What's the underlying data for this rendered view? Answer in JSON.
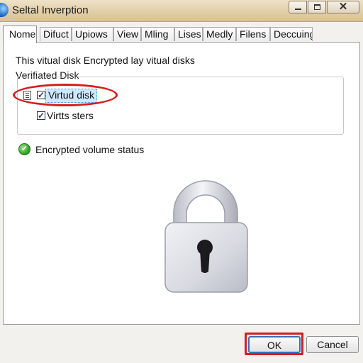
{
  "window": {
    "title": "Seltal Inverption",
    "icon": "app-globe-icon",
    "controls": {
      "minimize": "minimize-icon",
      "maximize": "maximize-icon",
      "close_glyph": "✕"
    }
  },
  "tabs": [
    {
      "label": "Nome",
      "active": true
    },
    {
      "label": "Difuct"
    },
    {
      "label": "Upiows"
    },
    {
      "label": "View"
    },
    {
      "label": "Mling"
    },
    {
      "label": "Lises"
    },
    {
      "label": "Medly"
    },
    {
      "label": "Filens"
    },
    {
      "label": "Deccuing"
    }
  ],
  "content": {
    "description": "This vitual disk Encrypted lay vitual disks",
    "group_label": "Verifiated Disk",
    "items": [
      {
        "label": "Virtud disk",
        "checked": true,
        "selected": true
      },
      {
        "label": "Virtts sters",
        "checked": true
      }
    ],
    "status": {
      "text": "Encrypted volume status",
      "icon": "check-circle-icon",
      "color": "#2c9a1f"
    },
    "illustration": "padlock-icon"
  },
  "buttons": {
    "ok": "OK",
    "cancel": "Cancel"
  },
  "colors": {
    "annotation_red": "#d81d1d",
    "selection": "#cce8ff",
    "titlebar": "#e2cfa9"
  }
}
